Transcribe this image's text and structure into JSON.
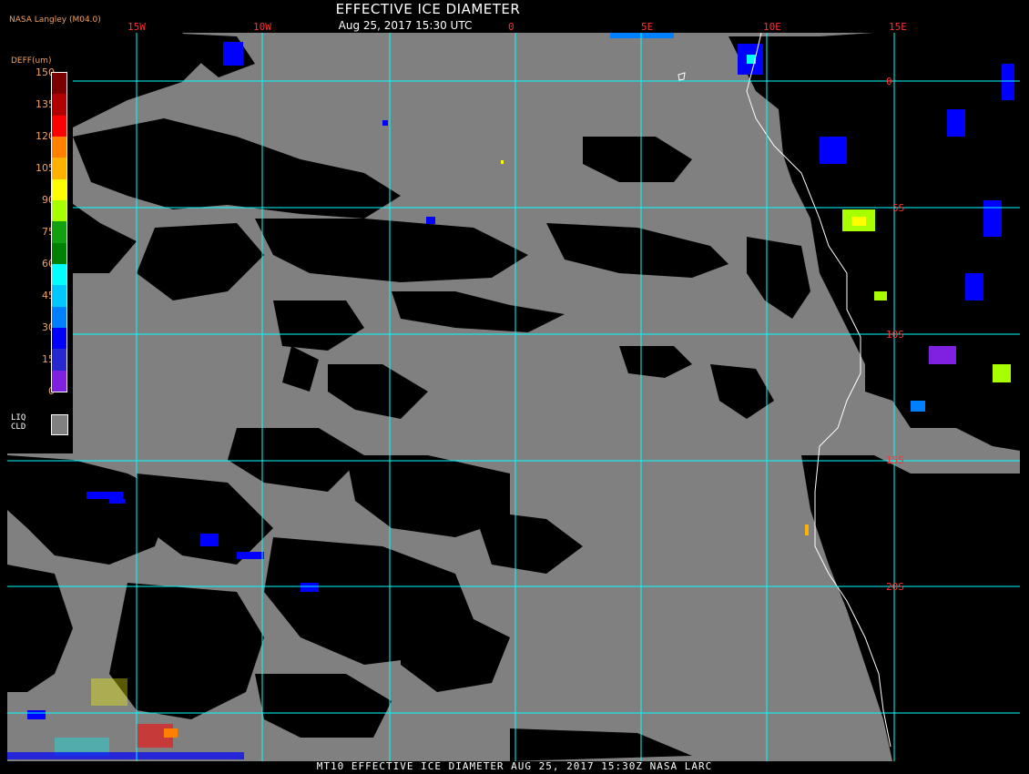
{
  "header": {
    "agency": "NASA Langley (M04.0)",
    "title": "EFFECTIVE ICE DIAMETER",
    "datetime": "Aug 25, 2017 15:30 UTC"
  },
  "longitude_labels": [
    "15W",
    "10W",
    "0",
    "5E",
    "10E",
    "15E"
  ],
  "latitude_labels": [
    "0",
    "5S",
    "10S",
    "15S",
    "20S"
  ],
  "legend": {
    "title": "DEFF(um)",
    "ticks": [
      "150",
      "135",
      "120",
      "105",
      "90",
      "75",
      "60",
      "45",
      "30",
      "15",
      "0"
    ],
    "colors": [
      "#7a0000",
      "#b00000",
      "#ff0000",
      "#ff8000",
      "#ffb000",
      "#ffff00",
      "#a8ff00",
      "#10a010",
      "#008000",
      "#00ffff",
      "#00c8ff",
      "#0080ff",
      "#0000ff",
      "#2828d0",
      "#8020e0"
    ],
    "liquid_label_line1": "LIQ",
    "liquid_label_line2": "CLD",
    "liquid_color": "#808080"
  },
  "footer": "MT10  EFFECTIVE ICE DIAMETER   AUG 25, 2017 15:30Z   NASA LARC",
  "colors": {
    "background": "#000000",
    "liquid_cloud": "#808080",
    "grid": "#00ffff",
    "coastline": "#ffffff",
    "label_red": "#ff3030",
    "label_orange": "#f0a060"
  }
}
